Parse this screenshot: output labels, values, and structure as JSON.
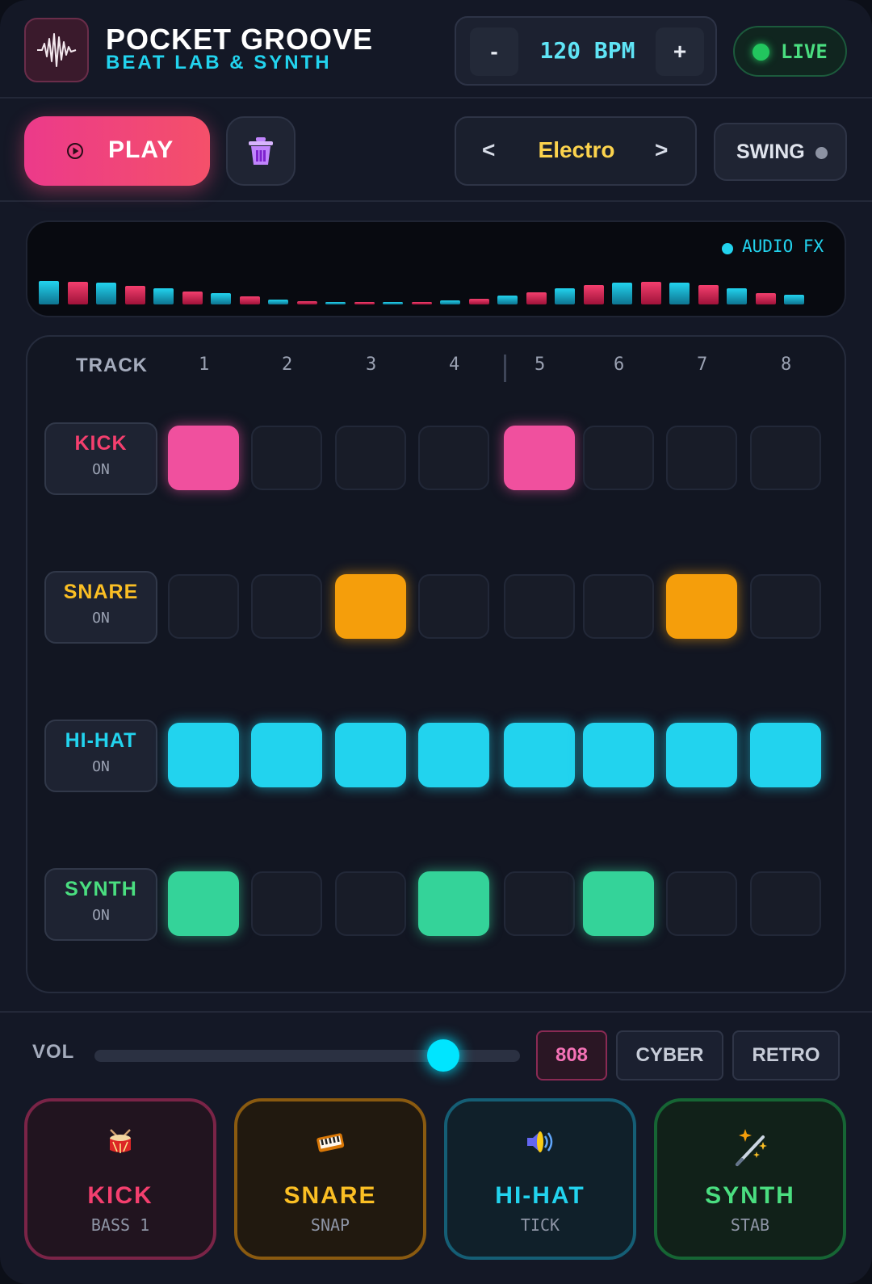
{
  "header": {
    "title": "POCKET GROOVE",
    "subtitle": "BEAT LAB & SYNTH",
    "bpm": {
      "minus_label": "-",
      "value_text": "120 BPM",
      "plus_label": "+"
    },
    "live_label": "LIVE"
  },
  "controls": {
    "play_label": "PLAY",
    "preset": {
      "prev_label": "<",
      "name": "Electro",
      "next_label": ">"
    },
    "swing_label": "SWING"
  },
  "visualizer": {
    "label": "AUDIO FX",
    "levels": [
      0.85,
      0.82,
      0.78,
      0.68,
      0.6,
      0.48,
      0.4,
      0.28,
      0.18,
      0.12,
      0.08,
      0.06,
      0.07,
      0.1,
      0.15,
      0.22,
      0.32,
      0.45,
      0.58,
      0.7,
      0.78,
      0.82,
      0.8,
      0.72,
      0.6,
      0.42,
      0.35
    ]
  },
  "sequencer": {
    "track_header": "TRACK",
    "steps": [
      "1",
      "2",
      "3",
      "4",
      "5",
      "6",
      "7",
      "8"
    ],
    "tracks": [
      {
        "name": "KICK",
        "state": "ON",
        "color": "#f0509e",
        "text_color": "#f43f6e",
        "pattern": [
          1,
          0,
          0,
          0,
          1,
          0,
          0,
          0
        ]
      },
      {
        "name": "SNARE",
        "state": "ON",
        "color": "#f59e0b",
        "text_color": "#fbbf24",
        "pattern": [
          0,
          0,
          1,
          0,
          0,
          0,
          1,
          0
        ]
      },
      {
        "name": "HI-HAT",
        "state": "ON",
        "color": "#22d3ee",
        "text_color": "#22d3ee",
        "pattern": [
          1,
          1,
          1,
          1,
          1,
          1,
          1,
          1
        ]
      },
      {
        "name": "SYNTH",
        "state": "ON",
        "color": "#34d399",
        "text_color": "#4ade80",
        "pattern": [
          1,
          0,
          0,
          1,
          0,
          1,
          0,
          0
        ]
      }
    ]
  },
  "mixer": {
    "vol_label": "VOL",
    "volume": 0.82,
    "kits": [
      "808",
      "CYBER",
      "RETRO"
    ],
    "active_kit": "808"
  },
  "pads": [
    {
      "name": "KICK",
      "sub": "BASS 1",
      "icon": "drum-icon",
      "color": "#f43f6e",
      "border": "#7a2447",
      "bg": "#21141f"
    },
    {
      "name": "SNARE",
      "sub": "SNAP",
      "icon": "keyboard-icon",
      "color": "#fbbf24",
      "border": "#8a5a10",
      "bg": "#21190f"
    },
    {
      "name": "HI-HAT",
      "sub": "TICK",
      "icon": "speaker-icon",
      "color": "#22d3ee",
      "border": "#155e75",
      "bg": "#10202a"
    },
    {
      "name": "SYNTH",
      "sub": "STAB",
      "icon": "magic-wand-icon",
      "color": "#4ade80",
      "border": "#166534",
      "bg": "#112119"
    }
  ]
}
